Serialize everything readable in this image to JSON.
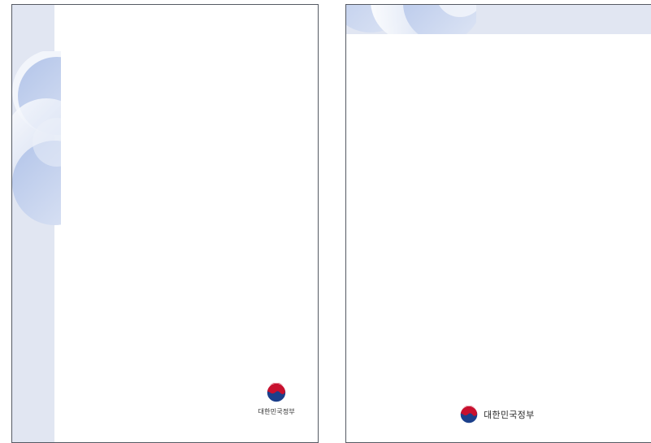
{
  "documents": [
    {
      "id": "left",
      "layout": "vertical-strip",
      "emblem": {
        "wordmark": "대한민국정부",
        "icon": "taegeuk-icon"
      }
    },
    {
      "id": "right",
      "layout": "horizontal-band",
      "emblem": {
        "wordmark": "대한민국정부",
        "icon": "taegeuk-icon"
      }
    }
  ],
  "colors": {
    "band": "#e1e6f2",
    "circle_blue": "#b4c6e8",
    "emblem_navy": "#1b3f8b",
    "emblem_red": "#c8102e",
    "page_border": "#555a63"
  }
}
